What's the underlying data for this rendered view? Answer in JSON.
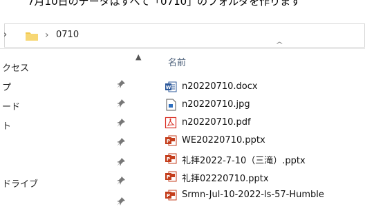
{
  "top_strip": {
    "text": "7月10日のデータはすべて「0710」のフォルダを作ります"
  },
  "address_bar": {
    "path": "0710"
  },
  "nav_pane": {
    "items": [
      {
        "label": "クセス"
      },
      {
        "label": "プ"
      },
      {
        "label": "ード"
      },
      {
        "label": "ト"
      },
      {
        "label": ""
      },
      {
        "label": ""
      },
      {
        "label": "ドライブ"
      }
    ]
  },
  "file_list": {
    "column_name": "名前",
    "files": [
      {
        "name": "n20220710.docx",
        "icon": "word-doc-icon"
      },
      {
        "name": "n20220710.jpg",
        "icon": "image-file-icon"
      },
      {
        "name": "n20220710.pdf",
        "icon": "pdf-icon"
      },
      {
        "name": "WE20220710.pptx",
        "icon": "powerpoint-icon"
      },
      {
        "name": "礼拝2022-7-10（三滝）.pptx",
        "icon": "powerpoint-icon"
      },
      {
        "name": "礼拝02220710.pptx",
        "icon": "powerpoint-icon"
      },
      {
        "name": "Srmn-Jul-10-2022-ls-57-Humble",
        "icon": "powerpoint-icon"
      }
    ]
  },
  "colors": {
    "accent_folder": "#f2c94c",
    "word": "#2b579a",
    "pdf": "#d93025",
    "ppt": "#c43e1c"
  }
}
